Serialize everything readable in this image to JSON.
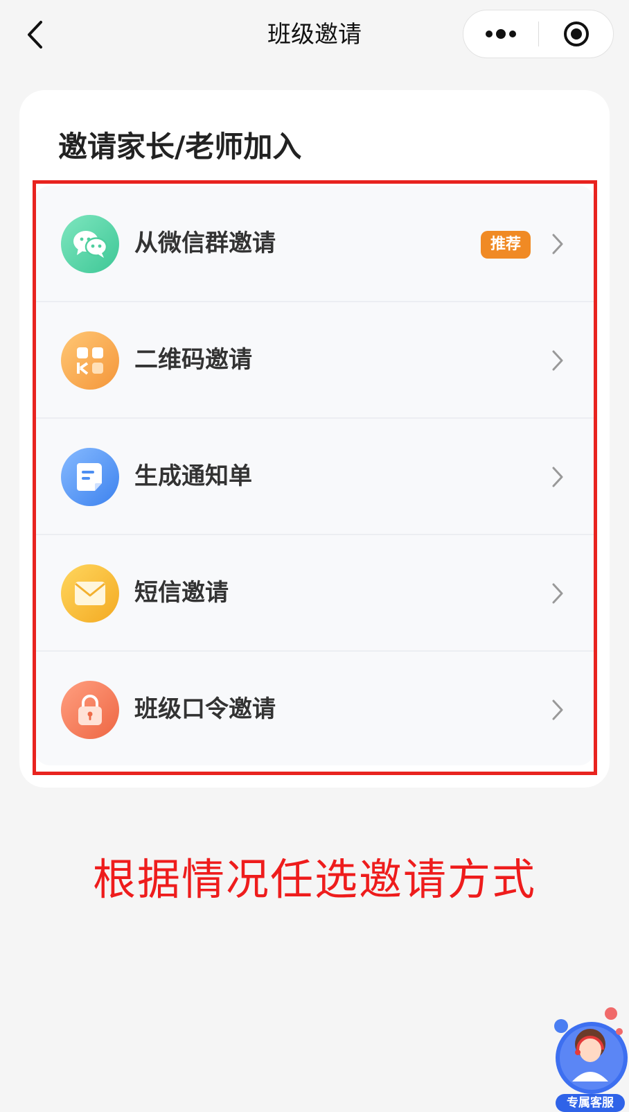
{
  "navbar": {
    "title": "班级邀请",
    "back_icon": "chevron-left-icon",
    "more_icon": "more-dots-icon",
    "close_icon": "target-circle-icon"
  },
  "card": {
    "title": "邀请家长/老师加入",
    "items": [
      {
        "label": "从微信群邀请",
        "icon": "wechat-icon",
        "badge": "推荐",
        "icon_colors": [
          "#6fe0b5",
          "#3ec796"
        ]
      },
      {
        "label": "二维码邀请",
        "icon": "qrcode-icon",
        "badge": "",
        "icon_colors": [
          "#ffc16b",
          "#f49a3a"
        ]
      },
      {
        "label": "生成通知单",
        "icon": "document-icon",
        "badge": "",
        "icon_colors": [
          "#7fb6ff",
          "#3f84f0"
        ]
      },
      {
        "label": "短信邀请",
        "icon": "envelope-icon",
        "badge": "",
        "icon_colors": [
          "#ffd35a",
          "#f3ad24"
        ]
      },
      {
        "label": "班级口令邀请",
        "icon": "lock-icon",
        "badge": "",
        "icon_colors": [
          "#ff9a7a",
          "#f06a45"
        ]
      }
    ]
  },
  "annotation": {
    "text": "根据情况任选邀请方式",
    "color": "#ee1c1c"
  },
  "customer_service": {
    "label": "专属客服",
    "icon": "customer-service-avatar-icon"
  },
  "colors": {
    "badge": "#f08a24",
    "highlight": "#e8231f",
    "background": "#f5f5f5"
  }
}
